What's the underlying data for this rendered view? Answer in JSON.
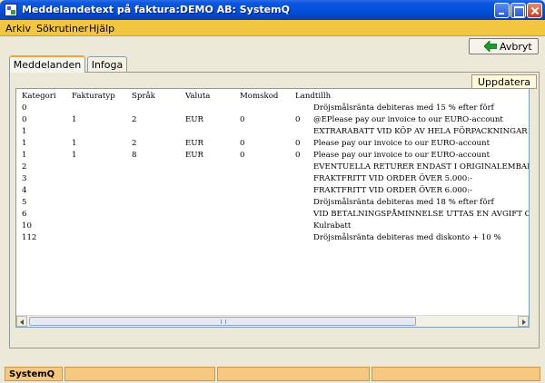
{
  "window": {
    "title": "Meddelandetext på faktura:DEMO AB: SystemQ"
  },
  "menu": [
    "Arkiv",
    "Sökrutiner",
    "Hjälp"
  ],
  "toolbar": {
    "cancel_label": "Avbryt"
  },
  "tabs": [
    "Meddelanden",
    "Infoga"
  ],
  "panel": {
    "refresh_label": "Uppdatera"
  },
  "table": {
    "headers": [
      "Kategori",
      "Fakturatyp",
      "Språk",
      "Valuta",
      "Momskod",
      "Landtillh"
    ],
    "rows": [
      [
        "0",
        "",
        "",
        "",
        "",
        "",
        "Dröjsmålsränta debiteras med 15 % efter förf"
      ],
      [
        "0",
        "1",
        "2",
        "EUR",
        "0",
        "0",
        "@EPlease pay our invoice to our EURO-account"
      ],
      [
        "1",
        "",
        "",
        "",
        "",
        "",
        "EXTRARABATT VID KÖP AV HELA FÖRPACKNINGAR"
      ],
      [
        "1",
        "1",
        "2",
        "EUR",
        "0",
        "0",
        "Please pay our invoice to our EURO-account"
      ],
      [
        "1",
        "1",
        "8",
        "EUR",
        "0",
        "0",
        "Please pay our invoice to our EURO-account"
      ],
      [
        "2",
        "",
        "",
        "",
        "",
        "",
        "EVENTUELLA RETURER ENDAST I ORIGINALEMBALAGE"
      ],
      [
        "3",
        "",
        "",
        "",
        "",
        "",
        "FRAKTFRITT VID ORDER ÖVER 5.000:-"
      ],
      [
        "4",
        "",
        "",
        "",
        "",
        "",
        "FRAKTFRITT VID ORDER ÖVER 6.000:-"
      ],
      [
        "5",
        "",
        "",
        "",
        "",
        "",
        "Dröjsmålsränta debiteras med 18 % efter förf"
      ],
      [
        "6",
        "",
        "",
        "",
        "",
        "",
        "VID BETALNINGSPÅMINNELSE UTTAS EN AVGIFT OM"
      ],
      [
        "10",
        "",
        "",
        "",
        "",
        "",
        "Kulrabatt"
      ],
      [
        "112",
        "",
        "",
        "",
        "",
        "",
        "Dröjsmålsränta debiteras med diskonto + 10 %"
      ]
    ]
  },
  "statusbar": {
    "cells": [
      "SystemQ",
      "",
      "",
      ""
    ]
  },
  "colors": {
    "menubar": "#F2C640",
    "status": "#F5C77F",
    "titlebar": "#0451D9"
  }
}
